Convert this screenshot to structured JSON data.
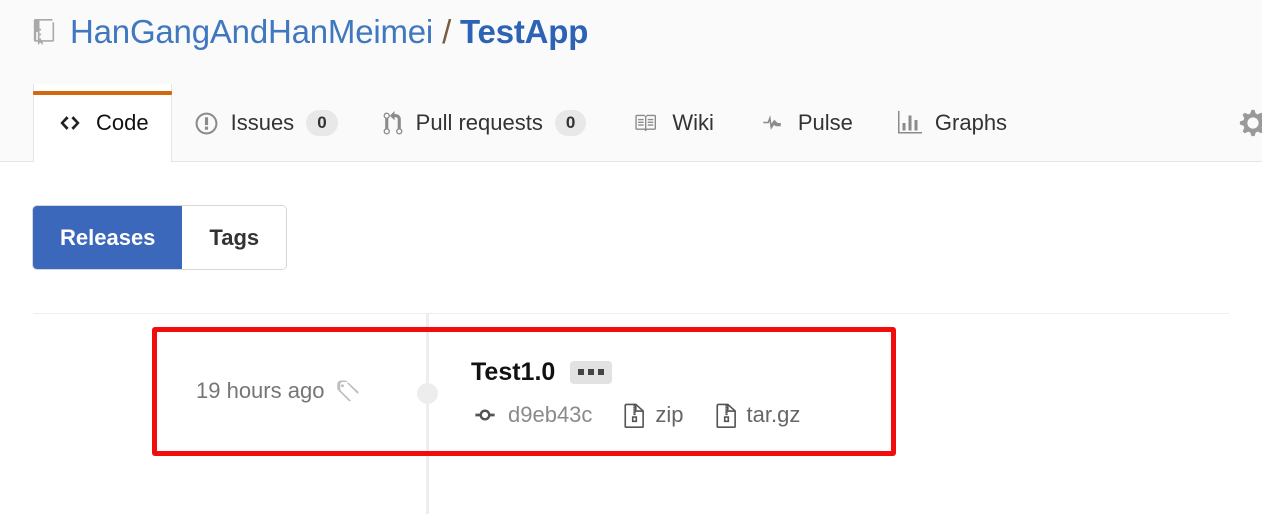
{
  "header": {
    "repo_icon": "repo-book-icon",
    "owner": "HanGangAndHanMeimei",
    "separator": "/",
    "name": "TestApp"
  },
  "nav": {
    "tabs": [
      {
        "id": "code",
        "label": "Code",
        "icon": "code-icon",
        "count": null,
        "selected": true
      },
      {
        "id": "issues",
        "label": "Issues",
        "icon": "issue-opened-icon",
        "count": "0",
        "selected": false
      },
      {
        "id": "pull-requests",
        "label": "Pull requests",
        "icon": "git-pull-request-icon",
        "count": "0",
        "selected": false
      },
      {
        "id": "wiki",
        "label": "Wiki",
        "icon": "book-icon",
        "count": null,
        "selected": false
      },
      {
        "id": "pulse",
        "label": "Pulse",
        "icon": "pulse-icon",
        "count": null,
        "selected": false
      },
      {
        "id": "graphs",
        "label": "Graphs",
        "icon": "graph-icon",
        "count": null,
        "selected": false
      }
    ],
    "settings_icon": "gear-icon",
    "active_tab_color": "#d26911"
  },
  "toolbar": {
    "releases_label": "Releases",
    "tags_label": "Tags",
    "active": "Releases",
    "active_color": "#3b68ba"
  },
  "releases": [
    {
      "relative_time": "19 hours ago",
      "tag_icon": "tag-icon",
      "title": "Test1.0",
      "menu_label": "...",
      "commit_icon": "git-commit-icon",
      "commit_sha": "d9eb43c",
      "assets": [
        {
          "icon": "file-zip-icon",
          "label": "zip"
        },
        {
          "icon": "file-zip-icon",
          "label": "tar.gz"
        }
      ]
    }
  ],
  "annotation": {
    "type": "highlight-rectangle",
    "color": "#f20d0d"
  }
}
